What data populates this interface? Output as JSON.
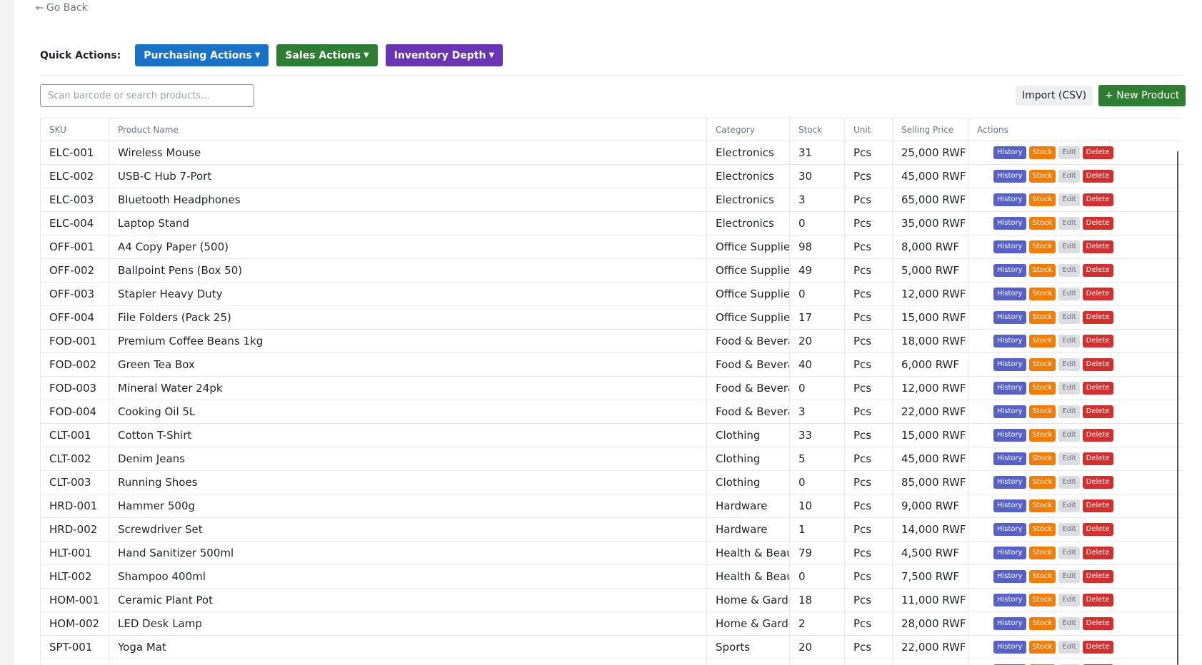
{
  "nav": {
    "go_back": "Go Back"
  },
  "quick_actions": {
    "label": "Quick Actions:",
    "purchasing": "Purchasing Actions",
    "sales": "Sales Actions",
    "inventory": "Inventory Depth"
  },
  "search": {
    "placeholder": "Scan barcode or search products..."
  },
  "toolbar": {
    "import": "Import (CSV)",
    "new_product": "+ New Product"
  },
  "table": {
    "headers": [
      "SKU",
      "Product Name",
      "Category",
      "Stock",
      "Unit",
      "Selling Price",
      "Actions"
    ],
    "action_labels": {
      "history": "History",
      "stock": "Stock",
      "edit": "Edit",
      "delete": "Delete"
    },
    "rows": [
      [
        "ELC-001",
        "Wireless Mouse",
        "Electronics",
        "31",
        "Pcs",
        "25,000 RWF"
      ],
      [
        "ELC-002",
        "USB-C Hub 7-Port",
        "Electronics",
        "30",
        "Pcs",
        "45,000 RWF"
      ],
      [
        "ELC-003",
        "Bluetooth Headphones",
        "Electronics",
        "3",
        "Pcs",
        "65,000 RWF"
      ],
      [
        "ELC-004",
        "Laptop Stand",
        "Electronics",
        "0",
        "Pcs",
        "35,000 RWF"
      ],
      [
        "OFF-001",
        "A4 Copy Paper (500)",
        "Office Supplies",
        "98",
        "Pcs",
        "8,000 RWF"
      ],
      [
        "OFF-002",
        "Ballpoint Pens (Box 50)",
        "Office Supplies",
        "49",
        "Pcs",
        "5,000 RWF"
      ],
      [
        "OFF-003",
        "Stapler Heavy Duty",
        "Office Supplies",
        "0",
        "Pcs",
        "12,000 RWF"
      ],
      [
        "OFF-004",
        "File Folders (Pack 25)",
        "Office Supplies",
        "17",
        "Pcs",
        "15,000 RWF"
      ],
      [
        "FOD-001",
        "Premium Coffee Beans 1kg",
        "Food & Beverages",
        "20",
        "Pcs",
        "18,000 RWF"
      ],
      [
        "FOD-002",
        "Green Tea Box",
        "Food & Beverages",
        "40",
        "Pcs",
        "6,000 RWF"
      ],
      [
        "FOD-003",
        "Mineral Water 24pk",
        "Food & Beverages",
        "0",
        "Pcs",
        "12,000 RWF"
      ],
      [
        "FOD-004",
        "Cooking Oil 5L",
        "Food & Beverages",
        "3",
        "Pcs",
        "22,000 RWF"
      ],
      [
        "CLT-001",
        "Cotton T-Shirt",
        "Clothing",
        "33",
        "Pcs",
        "15,000 RWF"
      ],
      [
        "CLT-002",
        "Denim Jeans",
        "Clothing",
        "5",
        "Pcs",
        "45,000 RWF"
      ],
      [
        "CLT-003",
        "Running Shoes",
        "Clothing",
        "0",
        "Pcs",
        "85,000 RWF"
      ],
      [
        "HRD-001",
        "Hammer 500g",
        "Hardware",
        "10",
        "Pcs",
        "9,000 RWF"
      ],
      [
        "HRD-002",
        "Screwdriver Set",
        "Hardware",
        "1",
        "Pcs",
        "14,000 RWF"
      ],
      [
        "HLT-001",
        "Hand Sanitizer 500ml",
        "Health & Beauty",
        "79",
        "Pcs",
        "4,500 RWF"
      ],
      [
        "HLT-002",
        "Shampoo 400ml",
        "Health & Beauty",
        "0",
        "Pcs",
        "7,500 RWF"
      ],
      [
        "HOM-001",
        "Ceramic Plant Pot",
        "Home & Garden",
        "18",
        "Pcs",
        "11,000 RWF"
      ],
      [
        "HOM-002",
        "LED Desk Lamp",
        "Home & Garden",
        "2",
        "Pcs",
        "28,000 RWF"
      ],
      [
        "SPT-001",
        "Yoga Mat",
        "Sports",
        "20",
        "Pcs",
        "22,000 RWF"
      ],
      [
        "",
        "",
        "",
        "",
        "",
        ""
      ]
    ]
  },
  "colors": {
    "purchasing": "#1872c8",
    "sales": "#2e7d32",
    "inventory": "#6a35b4",
    "history": "#5560c9",
    "stock": "#f57c00",
    "edit": "#dcdde0",
    "delete": "#d32f2f"
  }
}
